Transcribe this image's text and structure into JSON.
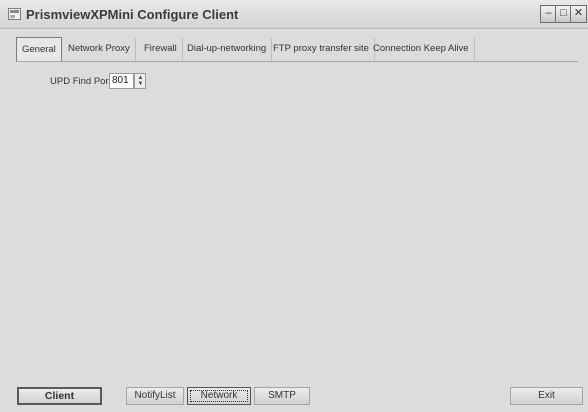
{
  "window": {
    "title": "PrismviewXPMini Configure Client"
  },
  "caption_buttons": {
    "minimize": "–",
    "maximize": "□",
    "close": "✕"
  },
  "tabs": [
    {
      "label": "General",
      "active": true
    },
    {
      "label": "Network Proxy"
    },
    {
      "label": "Firewall"
    },
    {
      "label": "Dial-up-networking"
    },
    {
      "label": "FTP proxy transfer site"
    },
    {
      "label": "Connection Keep Alive"
    }
  ],
  "general": {
    "port_label": "UPD Find Port:",
    "port_value": "801"
  },
  "bottom": {
    "client": "Client",
    "notifylist": "NotifyList",
    "network": "Network",
    "smtp": "SMTP",
    "exit": "Exit"
  },
  "icons": {
    "app": "app-window-icon",
    "spin_up": "up-arrow-icon",
    "spin_down": "down-arrow-icon"
  }
}
